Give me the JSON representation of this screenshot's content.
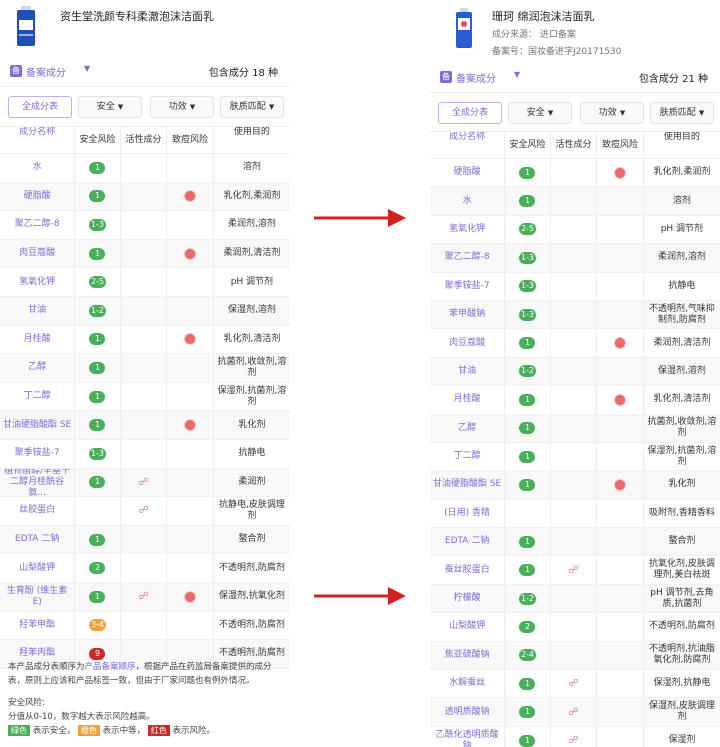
{
  "left": {
    "product_title": "资生堂洗颜专科柔澈泡沫洁面乳",
    "filing_badge": "备",
    "filing_label": "备案成分",
    "total_prefix": "包含成分",
    "total_count": "18",
    "total_unit": "种",
    "filters": [
      "全成分表",
      "安全",
      "功效",
      "肤质匹配"
    ],
    "headers": [
      "成分名称",
      "安全风险",
      "活性成分",
      "致痘风险",
      "使用目的"
    ],
    "rows": [
      {
        "name": "水",
        "safe": "1",
        "safe_color": "green",
        "active": false,
        "acne": false,
        "use": "溶剂"
      },
      {
        "name": "硬脂酸",
        "safe": "1",
        "safe_color": "green",
        "active": false,
        "acne": true,
        "use": "乳化剂,柔润剂"
      },
      {
        "name": "聚乙二醇-8",
        "safe": "1-3",
        "safe_color": "green",
        "active": false,
        "acne": false,
        "use": "柔润剂,溶剂"
      },
      {
        "name": "肉豆蔻酸",
        "safe": "1",
        "safe_color": "green",
        "active": false,
        "acne": true,
        "use": "柔润剂,清洁剂"
      },
      {
        "name": "氢氧化钾",
        "safe": "2-5",
        "safe_color": "green",
        "active": false,
        "acne": false,
        "use": "pH 调节剂"
      },
      {
        "name": "甘油",
        "safe": "1-2",
        "safe_color": "green",
        "active": false,
        "acne": false,
        "use": "保湿剂,溶剂"
      },
      {
        "name": "月桂酸",
        "safe": "1",
        "safe_color": "green",
        "active": false,
        "acne": true,
        "use": "乳化剂,清洁剂"
      },
      {
        "name": "乙醇",
        "safe": "1",
        "safe_color": "green",
        "active": false,
        "acne": false,
        "use": "抗菌剂,收敛剂,溶剂"
      },
      {
        "name": "丁二醇",
        "safe": "1",
        "safe_color": "green",
        "active": false,
        "acne": false,
        "use": "保湿剂,抗菌剂,溶剂"
      },
      {
        "name": "甘油硬脂酸酯 SE",
        "safe": "1",
        "safe_color": "green",
        "active": false,
        "acne": true,
        "use": "乳化剂"
      },
      {
        "name": "聚季铵盐-7",
        "safe": "1-3",
        "safe_color": "green",
        "active": false,
        "acne": false,
        "use": "抗静电"
      },
      {
        "name": "植物甾醇/辛基十二醇月桂酰谷氨...",
        "safe": "1",
        "safe_color": "green",
        "active": true,
        "acne": false,
        "use": "柔润剂"
      },
      {
        "name": "丝胶蛋白",
        "safe": "",
        "safe_color": "",
        "active": true,
        "acne": false,
        "use": "抗静电,皮肤调理剂"
      },
      {
        "name": "EDTA 二钠",
        "safe": "1",
        "safe_color": "green",
        "active": false,
        "acne": false,
        "use": "螯合剂"
      },
      {
        "name": "山梨酸钾",
        "safe": "2",
        "safe_color": "green",
        "active": false,
        "acne": false,
        "use": "不透明剂,防腐剂"
      },
      {
        "name": "生育酚 (维生素 E)",
        "safe": "1",
        "safe_color": "green",
        "active": true,
        "acne": true,
        "use": "保湿剂,抗氧化剂"
      },
      {
        "name": "羟苯甲酯",
        "safe": "3-4",
        "safe_color": "orange",
        "active": false,
        "acne": false,
        "use": "不透明剂,防腐剂"
      },
      {
        "name": "羟苯丙酯",
        "safe": "9",
        "safe_color": "red",
        "active": false,
        "acne": false,
        "use": "不透明剂,防腐剂"
      }
    ],
    "footer": {
      "p1_a": "本产品成分表顺序为",
      "p1_link": "产品备案顺序",
      "p1_b": "，根据产品在药监局备案提供的成分表，原则上应该和产品标签一致，但由于厂家问题也有例外情况。",
      "p2_title": "安全风险:",
      "p2_line": "分值从0-10，数字越大表示风险越高。",
      "tag_green": "绿色",
      "txt_green": "表示安全，",
      "tag_orange": "橙色",
      "txt_orange": "表示中等，",
      "tag_red": "红色",
      "txt_red": "表示风险。"
    }
  },
  "right": {
    "product_title": "珊珂 绵润泡沫洁面乳",
    "source_label": "成分来源：",
    "source_value": "进口备案",
    "reg_label": "备案号：",
    "reg_value": "国妆备进字J20171530",
    "filing_badge": "备",
    "filing_label": "备案成分",
    "total_prefix": "包含成分",
    "total_count": "21",
    "total_unit": "种",
    "filters": [
      "全成分表",
      "安全",
      "功效",
      "肤质匹配"
    ],
    "headers": [
      "成分名称",
      "安全风险",
      "活性成分",
      "致痘风险",
      "使用目的"
    ],
    "rows": [
      {
        "name": "硬脂酸",
        "safe": "1",
        "safe_color": "green",
        "active": false,
        "acne": true,
        "use": "乳化剂,柔润剂"
      },
      {
        "name": "水",
        "safe": "1",
        "safe_color": "green",
        "active": false,
        "acne": false,
        "use": "溶剂"
      },
      {
        "name": "氢氧化钾",
        "safe": "2-5",
        "safe_color": "green",
        "active": false,
        "acne": false,
        "use": "pH 调节剂"
      },
      {
        "name": "聚乙二醇-8",
        "safe": "1-3",
        "safe_color": "green",
        "active": false,
        "acne": false,
        "use": "柔润剂,溶剂"
      },
      {
        "name": "聚季铵盐-7",
        "safe": "1-3",
        "safe_color": "green",
        "active": false,
        "acne": false,
        "use": "抗静电"
      },
      {
        "name": "苯甲酸钠",
        "safe": "1-3",
        "safe_color": "green",
        "active": false,
        "acne": false,
        "use": "不透明剂,气味抑制剂,防腐剂"
      },
      {
        "name": "肉豆蔻酸",
        "safe": "1",
        "safe_color": "green",
        "active": false,
        "acne": true,
        "use": "柔润剂,清洁剂"
      },
      {
        "name": "甘油",
        "safe": "1-2",
        "safe_color": "green",
        "active": false,
        "acne": false,
        "use": "保湿剂,溶剂"
      },
      {
        "name": "月桂酸",
        "safe": "1",
        "safe_color": "green",
        "active": false,
        "acne": true,
        "use": "乳化剂,清洁剂"
      },
      {
        "name": "乙醇",
        "safe": "1",
        "safe_color": "green",
        "active": false,
        "acne": false,
        "use": "抗菌剂,收敛剂,溶剂"
      },
      {
        "name": "丁二醇",
        "safe": "1",
        "safe_color": "green",
        "active": false,
        "acne": false,
        "use": "保湿剂,抗菌剂,溶剂"
      },
      {
        "name": "甘油硬脂酸酯 SE",
        "safe": "1",
        "safe_color": "green",
        "active": false,
        "acne": true,
        "use": "乳化剂"
      },
      {
        "name": "(日用) 香精",
        "safe": "",
        "safe_color": "",
        "active": false,
        "acne": false,
        "use": "吸附剂,香精香料"
      },
      {
        "name": "EDTA 二钠",
        "safe": "1",
        "safe_color": "green",
        "active": false,
        "acne": false,
        "use": "螯合剂"
      },
      {
        "name": "蚕丝胶蛋白",
        "safe": "1",
        "safe_color": "green",
        "active": true,
        "acne": false,
        "use": "抗氧化剂,皮肤调理剂,美白祛斑"
      },
      {
        "name": "柠檬酸",
        "safe": "1-2",
        "safe_color": "green",
        "active": false,
        "acne": false,
        "use": "pH 调节剂,去角质,抗菌剂"
      },
      {
        "name": "山梨酸钾",
        "safe": "2",
        "safe_color": "green",
        "active": false,
        "acne": false,
        "use": "不透明剂,防腐剂"
      },
      {
        "name": "焦亚硫酸钠",
        "safe": "2-4",
        "safe_color": "green",
        "active": false,
        "acne": false,
        "use": "不透明剂,抗油脂氧化剂,防腐剂"
      },
      {
        "name": "水解蚕丝",
        "safe": "1",
        "safe_color": "green",
        "active": true,
        "acne": false,
        "use": "保湿剂,抗静电"
      },
      {
        "name": "透明质酸钠",
        "safe": "1",
        "safe_color": "green",
        "active": true,
        "acne": false,
        "use": "保湿剂,皮肤调理剂"
      },
      {
        "name": "乙酰化透明质酸钠",
        "safe": "1",
        "safe_color": "green",
        "active": true,
        "acne": false,
        "use": "保湿剂"
      }
    ]
  },
  "colors": {
    "accent": "#7b6fd6",
    "safe": "#4aaf5b",
    "medium": "#f0a33c",
    "risk": "#c92a2a",
    "arrow": "#d32020",
    "acne": "#e86a6a"
  },
  "icons": {
    "active": "dna-icon",
    "acne": "acne-dot-icon",
    "filing": "filing-badge-icon",
    "arrow": "red-arrow-icon"
  }
}
